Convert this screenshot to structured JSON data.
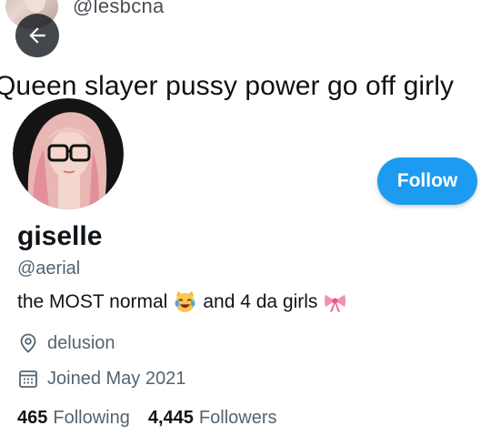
{
  "banner": {
    "handle": "@lesbcna",
    "caption": "Queen slayer pussy power go off girly"
  },
  "profile": {
    "display_name": "giselle",
    "username": "@aerial",
    "bio_part1": "the MOST normal",
    "bio_emoji1": "laughing-cat-emoji",
    "bio_part2": "and 4 da girls",
    "bio_emoji2": "pink-ribbon-emoji",
    "location": "delusion",
    "joined": "Joined May 2021"
  },
  "actions": {
    "follow_label": "Follow"
  },
  "stats": {
    "following_count": "465",
    "following_label": "Following",
    "followers_count": "4,445",
    "followers_label": "Followers"
  },
  "colors": {
    "accent": "#1d9bf0",
    "secondary_text": "#536471",
    "primary_text": "#0f1419"
  }
}
